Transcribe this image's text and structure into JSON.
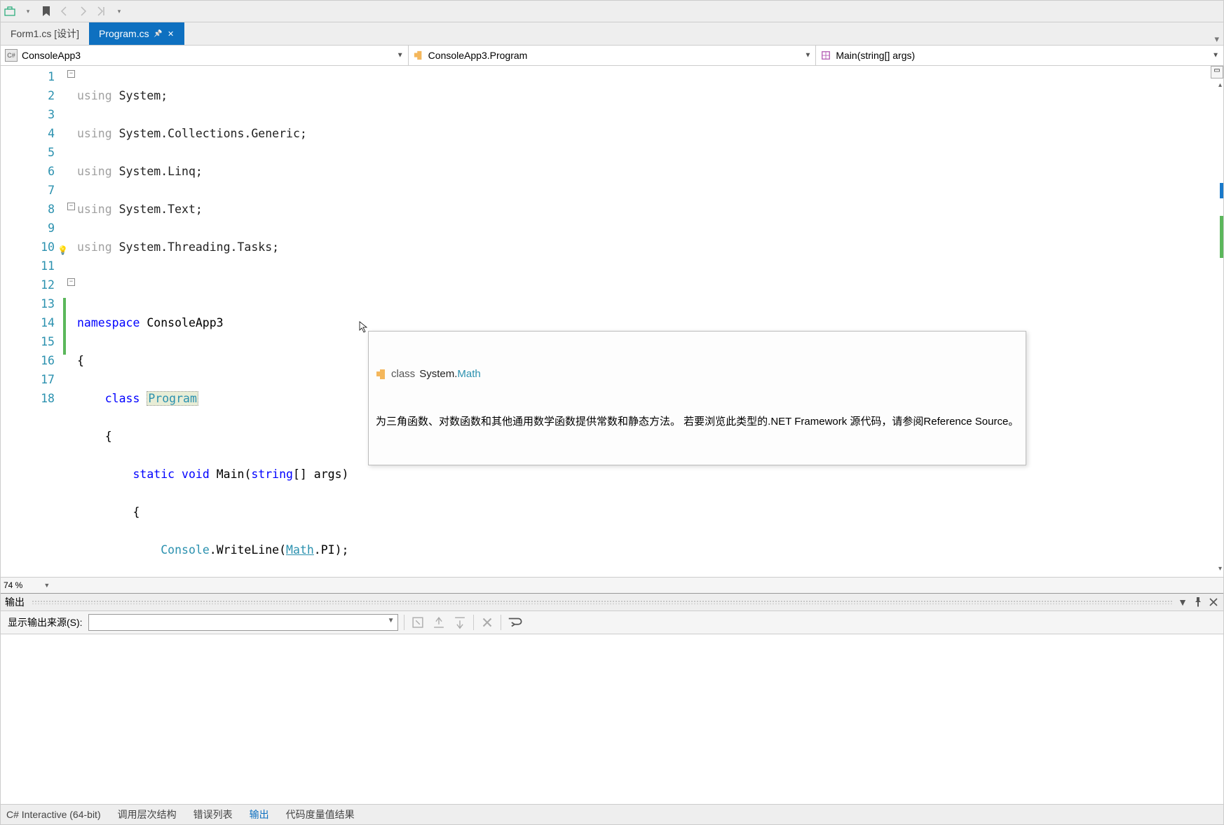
{
  "toolbar": {},
  "tabs": {
    "inactive": "Form1.cs [设计]",
    "active": "Program.cs"
  },
  "nav": {
    "project": "ConsoleApp3",
    "class": "ConsoleApp3.Program",
    "method": "Main(string[] args)"
  },
  "gutter_lines": [
    "1",
    "2",
    "3",
    "4",
    "5",
    "6",
    "7",
    "8",
    "9",
    "10",
    "11",
    "12",
    "13",
    "14",
    "15",
    "16",
    "17",
    "18"
  ],
  "code": {
    "l1_kw": "using",
    "l1_ns": " System;",
    "l2_kw": "using",
    "l2_ns": " System.Collections.Generic;",
    "l3_kw": "using",
    "l3_ns": " System.Linq;",
    "l4_kw": "using",
    "l4_ns": " System.Text;",
    "l5_kw": "using",
    "l5_ns": " System.Threading.Tasks;",
    "l6": "",
    "l7": "",
    "l8_kw": "namespace",
    "l8_ns": " ConsoleApp3",
    "l9": "{",
    "l10_ind": "    ",
    "l10_kw": "class ",
    "l10_cls": "Program",
    "l11": "    {",
    "l12_ind": "        ",
    "l12_kw1": "static ",
    "l12_kw2": "void ",
    "l12_m": "Main(",
    "l12_kw3": "string",
    "l12_rest": "[] args)",
    "l13": "        {",
    "l14_ind": "            ",
    "l14_cls": "Console",
    "l14_dot": ".WriteLine(",
    "l14_math": "Math",
    "l14_rest": ".PI);",
    "l15": "        }",
    "l16": "    }",
    "l17": "}",
    "l18": ""
  },
  "tooltip": {
    "kind": "class",
    "ns": "System.",
    "sym": "Math",
    "desc": "为三角函数、对数函数和其他通用数学函数提供常数和静态方法。 若要浏览此类型的.NET Framework 源代码，请参阅Reference Source。"
  },
  "zoom": "74 %",
  "output": {
    "title": "输出",
    "source_label": "显示输出来源(S):"
  },
  "bottom_tabs": {
    "t1": "C# Interactive (64-bit)",
    "t2": "调用层次结构",
    "t3": "错误列表",
    "t4": "输出",
    "t5": "代码度量值结果"
  }
}
